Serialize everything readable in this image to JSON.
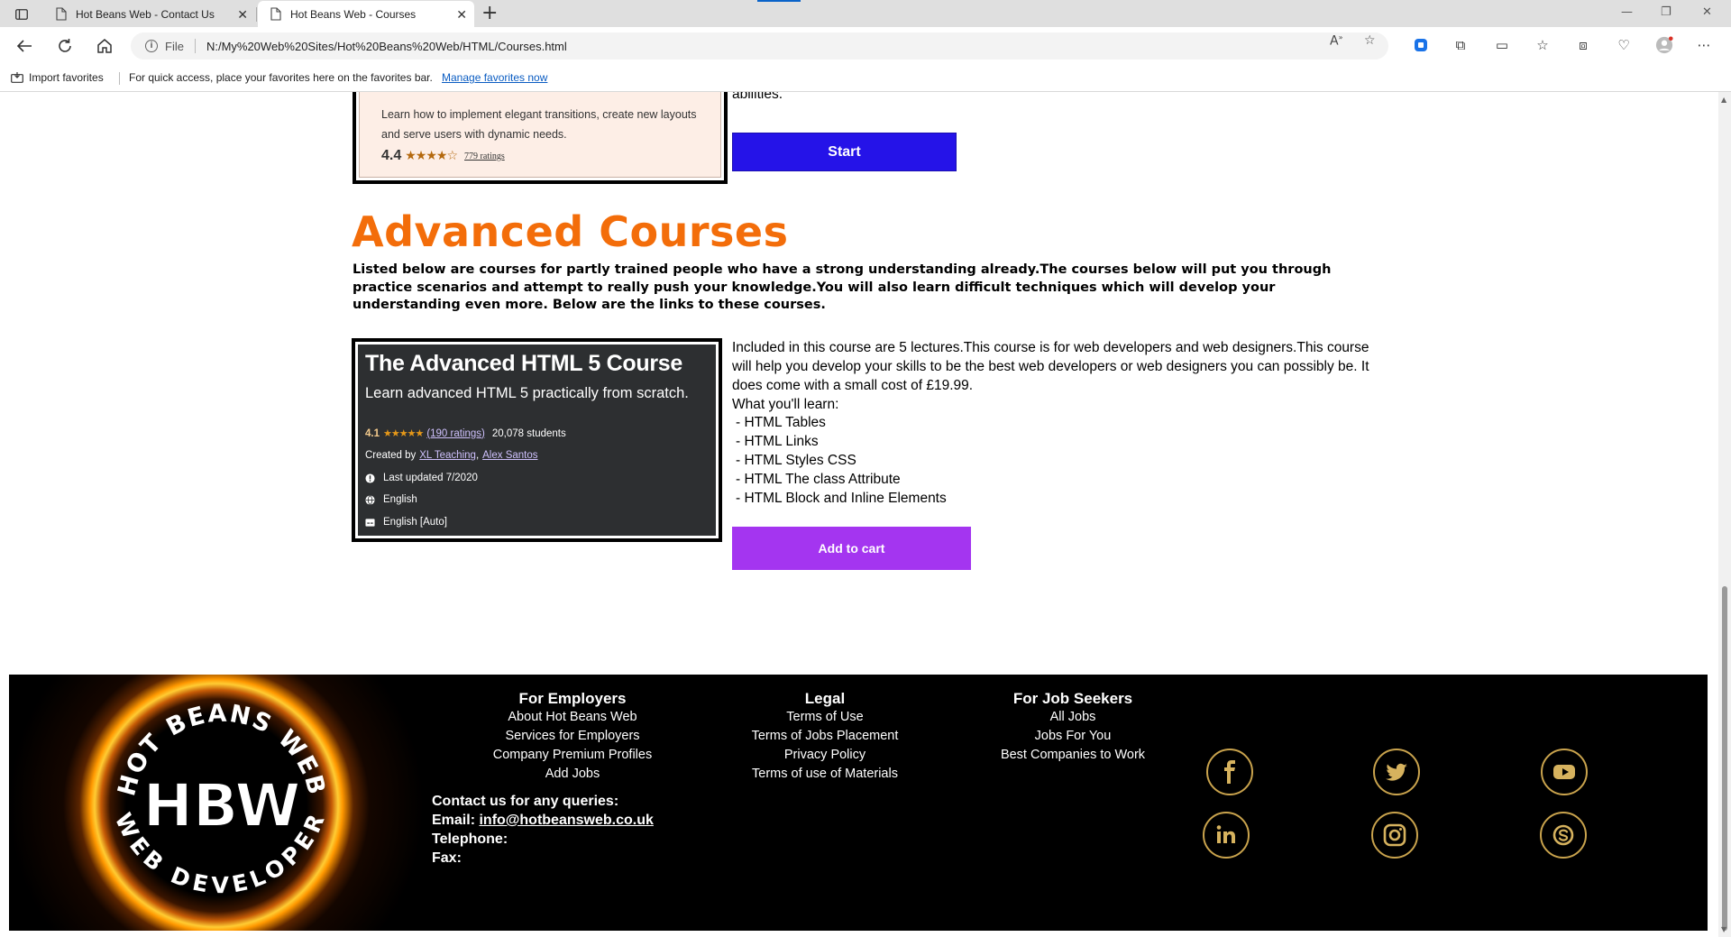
{
  "browser": {
    "tabs": [
      {
        "title": "Hot Beans Web - Contact Us"
      },
      {
        "title": "Hot Beans Web - Courses"
      }
    ],
    "address": {
      "scheme": "File",
      "url": "N:/My%20Web%20Sites/Hot%20Beans%20Web/HTML/Courses.html"
    },
    "favorites_bar": {
      "import_label": "Import favorites",
      "hint": "For quick access, place your favorites here on the favorites bar.",
      "manage_link": "Manage favorites now"
    }
  },
  "prev_course": {
    "description": "Learn how to implement elegant transitions, create new layouts and serve users with dynamic needs.",
    "rating": "4.4",
    "stars": "★★★★☆",
    "ratings_count": "779 ratings",
    "side_text": "abilities.",
    "start_label": "Start"
  },
  "advanced": {
    "title": "Advanced Courses",
    "intro": "Listed below are courses for partly trained people who have a strong understanding already.The courses below will put you through practice scenarios and attempt to really push your knowledge.You will also learn difficult techniques which will develop your understanding even more. Below are the links to these courses.",
    "course": {
      "title": "The Advanced HTML 5 Course",
      "subtitle": "Learn advanced HTML 5 practically from scratch.",
      "rating": "4.1",
      "stars": "★★★★★",
      "ratings_count": "(190 ratings)",
      "students": "20,078 students",
      "created_by_label": "Created by",
      "author1": "XL Teaching",
      "author_sep": ",",
      "author2": "Alex Santos",
      "last_updated": "Last updated 7/2020",
      "language": "English",
      "captions": "English [Auto]"
    },
    "description": "Included in this course are 5 lectures.This course is for web developers and web designers.This course will help you develop your skills to be the best web developers or web designers you can possibly be. It does come with a small cost of £19.99.",
    "learn_heading": "What you'll learn:",
    "learn_items": [
      "- HTML Tables",
      "- HTML Links",
      "- HTML Styles CSS",
      "- HTML The class Attribute",
      "- HTML Block and Inline Elements"
    ],
    "cart_label": "Add to cart"
  },
  "footer": {
    "logo_text": {
      "top": "HOT BEANS WEB",
      "center": "HBW",
      "bottom": "WEB DEVELOPER"
    },
    "employers": {
      "heading": "For Employers",
      "links": [
        "About Hot Beans Web",
        "Services for Employers",
        "Company Premium Profiles",
        "Add Jobs"
      ]
    },
    "legal": {
      "heading": "Legal",
      "links": [
        "Terms of Use",
        "Terms of Jobs Placement",
        "Privacy Policy",
        "Terms of use of Materials"
      ]
    },
    "seekers": {
      "heading": "For Job Seekers",
      "links": [
        "All Jobs",
        "Jobs For You",
        "Best Companies to Work"
      ]
    },
    "contact": {
      "heading": "Contact us for any queries:",
      "email_label": "Email:",
      "email": "info@hotbeansweb.co.uk",
      "telephone_label": "Telephone:",
      "fax_label": "Fax:"
    },
    "social": [
      "facebook-icon",
      "twitter-icon",
      "youtube-icon",
      "linkedin-icon",
      "instagram-icon",
      "skype-icon"
    ],
    "accent_color": "#c9a34d"
  },
  "colors": {
    "heading_orange": "#f36d0a",
    "start_blue": "#2513e8",
    "cart_purple": "#a435f0"
  }
}
